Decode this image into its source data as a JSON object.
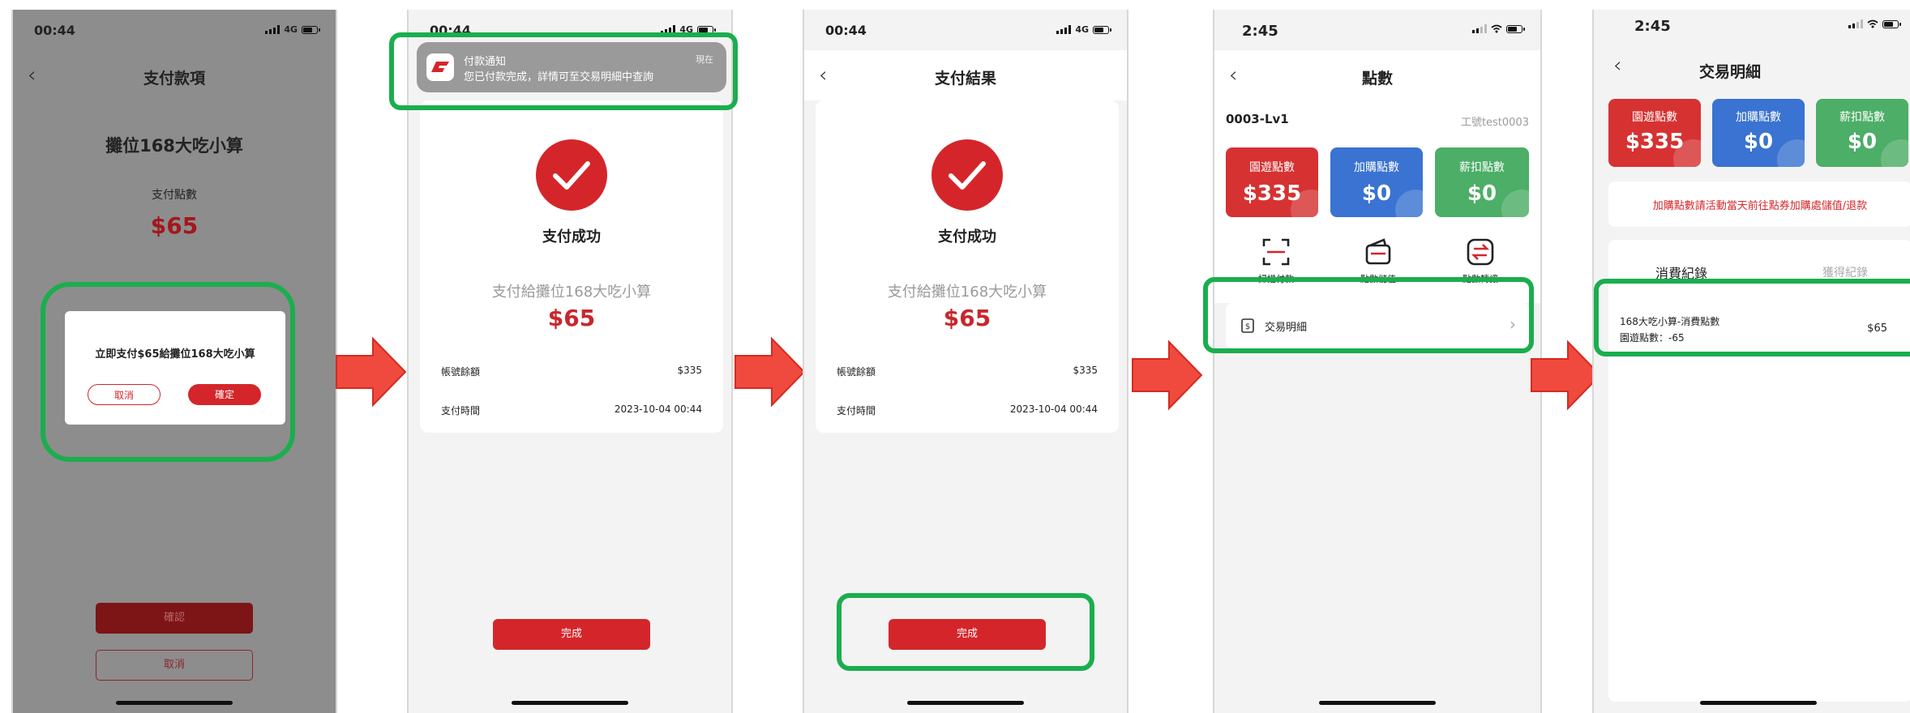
{
  "colors": {
    "accent_red": "#d4262a",
    "highlight_green": "#1aae4e",
    "arrow_red": "#f04a3e",
    "tile_red": "#d63232",
    "tile_blue": "#3a73d1",
    "tile_green": "#4cae67"
  },
  "screen1": {
    "time": "00:44",
    "network": "4G",
    "title": "支付款項",
    "store": "攤位168大吃小算",
    "points_label": "支付點數",
    "amount": "$65",
    "dialog_message": "立即支付$65給攤位168大吃小算",
    "dialog_cancel": "取消",
    "dialog_confirm": "確定",
    "confirm_button": "確認",
    "cancel_button": "取消"
  },
  "screen2": {
    "time": "00:44",
    "network": "4G",
    "notif_title": "付款通知",
    "notif_time": "現在",
    "notif_body": "您已付款完成，詳情可至交易明細中查詢",
    "success": "支付成功",
    "payee": "支付給攤位168大吃小算",
    "amount": "$65",
    "balance_label": "帳號餘額",
    "balance_value": "$335",
    "time_label": "支付時間",
    "time_value": "2023-10-04 00:44",
    "done": "完成"
  },
  "screen3": {
    "time": "00:44",
    "network": "4G",
    "title": "支付結果",
    "success": "支付成功",
    "payee": "支付給攤位168大吃小算",
    "amount": "$65",
    "balance_label": "帳號餘額",
    "balance_value": "$335",
    "time_label": "支付時間",
    "time_value": "2023-10-04 00:44",
    "done": "完成"
  },
  "screen4": {
    "time": "2:45",
    "title": "點數",
    "account": "0003-Lv1",
    "user": "工號test0003",
    "tiles": [
      {
        "label": "園遊點數",
        "value": "$335"
      },
      {
        "label": "加購點數",
        "value": "$0"
      },
      {
        "label": "薪扣點數",
        "value": "$0"
      }
    ],
    "actions": [
      {
        "label": "掃描付款",
        "icon": "scan-icon"
      },
      {
        "label": "點數儲值",
        "icon": "wallet-icon"
      },
      {
        "label": "點數轉讓",
        "icon": "transfer-icon"
      }
    ],
    "menu_item": "交易明細"
  },
  "screen5": {
    "time": "2:45",
    "title": "交易明細",
    "tiles": [
      {
        "label": "園遊點數",
        "value": "$335"
      },
      {
        "label": "加購點數",
        "value": "$0"
      },
      {
        "label": "薪扣點數",
        "value": "$0"
      }
    ],
    "notice": "加購點數請活動當天前往點券加購處儲值/退款",
    "tab_spend": "消費紀錄",
    "tab_earn": "獲得紀錄",
    "records": [
      {
        "title": "168大吃小算-消費點數",
        "detail": "園遊點數：-65",
        "amount": "$65"
      }
    ]
  }
}
